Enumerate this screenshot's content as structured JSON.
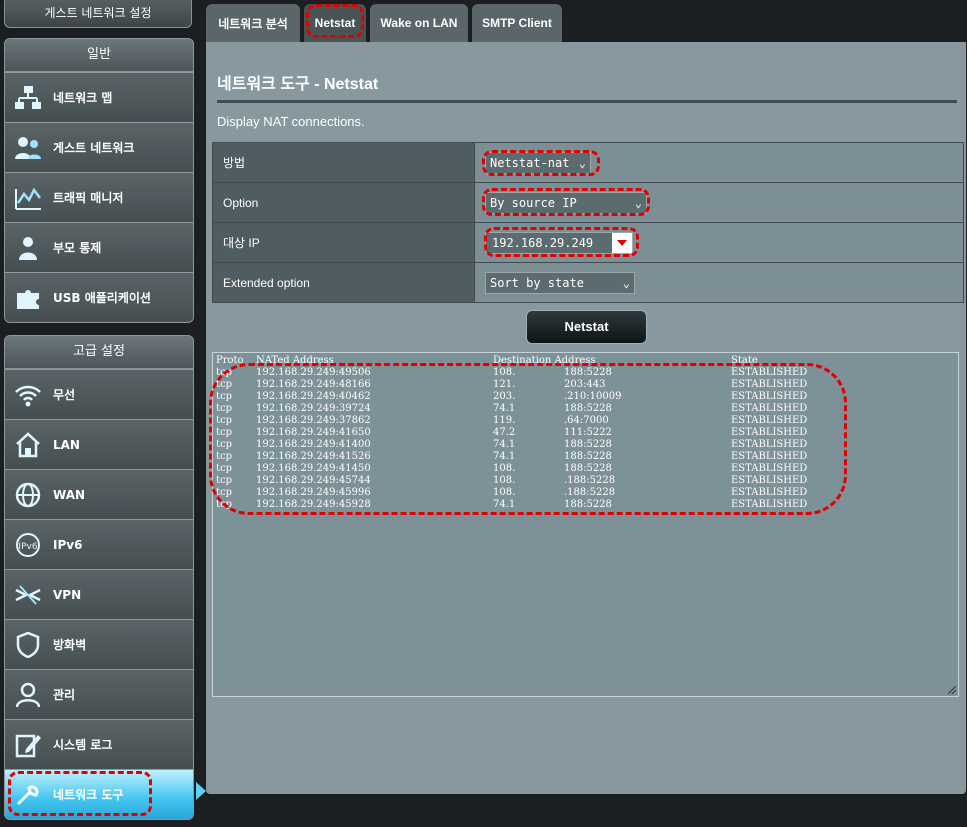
{
  "sidebar": {
    "top_button": "게스트 네트워크 설정",
    "general": {
      "header": "일반",
      "items": [
        {
          "label": "네트워크 맵",
          "icon": "network-map-icon"
        },
        {
          "label": "게스트 네트워크",
          "icon": "guest-network-icon"
        },
        {
          "label": "트래픽 매니저",
          "icon": "traffic-manager-icon"
        },
        {
          "label": "부모 통제",
          "icon": "parental-control-icon"
        },
        {
          "label": "USB 애플리케이션",
          "icon": "usb-application-icon"
        }
      ]
    },
    "advanced": {
      "header": "고급 설정",
      "items": [
        {
          "label": "무선",
          "icon": "wireless-icon"
        },
        {
          "label": "LAN",
          "icon": "lan-icon"
        },
        {
          "label": "WAN",
          "icon": "wan-icon"
        },
        {
          "label": "IPv6",
          "icon": "ipv6-icon"
        },
        {
          "label": "VPN",
          "icon": "vpn-icon"
        },
        {
          "label": "방화벽",
          "icon": "firewall-icon"
        },
        {
          "label": "관리",
          "icon": "administration-icon"
        },
        {
          "label": "시스템 로그",
          "icon": "system-log-icon"
        },
        {
          "label": "네트워크 도구",
          "icon": "network-tools-icon",
          "active": true
        }
      ]
    }
  },
  "tabs": [
    {
      "label": "네트워크 분석"
    },
    {
      "label": "Netstat",
      "active": true
    },
    {
      "label": "Wake on LAN"
    },
    {
      "label": "SMTP Client"
    }
  ],
  "panel": {
    "title": "네트워크 도구 - Netstat",
    "description": "Display NAT connections.",
    "rows": {
      "method": {
        "label": "방법",
        "value": "Netstat-nat"
      },
      "option": {
        "label": "Option",
        "value": "By source IP"
      },
      "target_ip": {
        "label": "대상 IP",
        "value": "192.168.29.249"
      },
      "extended": {
        "label": "Extended option",
        "value": "Sort by state"
      }
    },
    "button": "Netstat",
    "output": {
      "headers": [
        "Proto",
        "NATed Address",
        "Destination Address",
        "State"
      ],
      "rows": [
        [
          "tcp",
          "192.168.29.249:49506",
          "108.",
          "188:5228",
          "ESTABLISHED"
        ],
        [
          "tcp",
          "192.168.29.249:48166",
          "121.",
          "203:443",
          "ESTABLISHED"
        ],
        [
          "tcp",
          "192.168.29.249:40462",
          "203.",
          ".210:10009",
          "ESTABLISHED"
        ],
        [
          "tcp",
          "192.168.29.249:39724",
          "74.1",
          "188:5228",
          "ESTABLISHED"
        ],
        [
          "tcp",
          "192.168.29.249:37862",
          "119.",
          ".64:7000",
          "ESTABLISHED"
        ],
        [
          "tcp",
          "192.168.29.249:41650",
          "47.2",
          "111:5222",
          "ESTABLISHED"
        ],
        [
          "tcp",
          "192.168.29.249:41400",
          "74.1",
          "188:5228",
          "ESTABLISHED"
        ],
        [
          "tcp",
          "192.168.29.249:41526",
          "74.1",
          "188:5228",
          "ESTABLISHED"
        ],
        [
          "tcp",
          "192.168.29.249:41450",
          "108.",
          "188:5228",
          "ESTABLISHED"
        ],
        [
          "tcp",
          "192.168.29.249:45744",
          "108.",
          ".188:5228",
          "ESTABLISHED"
        ],
        [
          "tcp",
          "192.168.29.249:45996",
          "108.",
          ".188:5228",
          "ESTABLISHED"
        ],
        [
          "tcp",
          "192.168.29.249:45928",
          "74.1",
          "188:5228",
          "ESTABLISHED"
        ]
      ]
    }
  },
  "colors": {
    "highlight": "#e00000",
    "active_menu": "#43c5ef",
    "panel_bg": "#87999f"
  }
}
